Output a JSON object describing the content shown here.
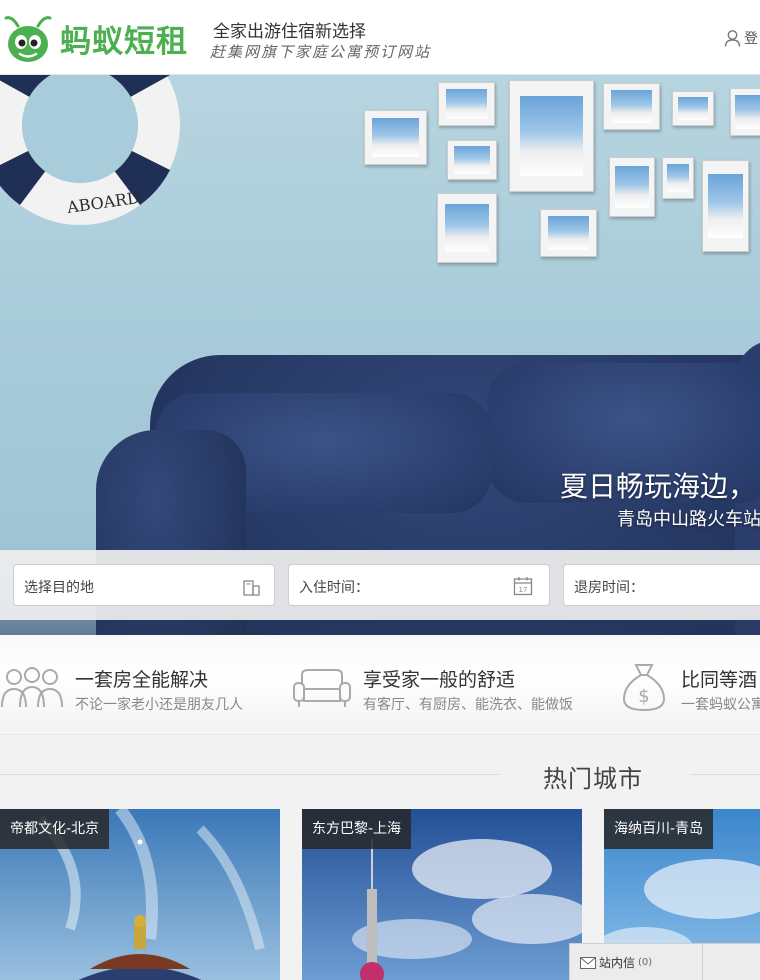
{
  "header": {
    "logo_text": "蚂蚁短租",
    "slogan_main": "全家出游住宿新选择",
    "slogan_sub": "赶集网旗下家庭公寓预订网站",
    "login_label": "登"
  },
  "hero": {
    "lifebuoy_text": "ABOARD",
    "title": "夏日畅玩海边，",
    "subtitle": "青岛中山路火车站"
  },
  "search": {
    "destination_placeholder": "选择目的地",
    "checkin_placeholder": "入住时间：",
    "checkout_placeholder": "退房时间：",
    "calendar_day": "17"
  },
  "features": [
    {
      "icon": "family-icon",
      "title": "一套房全能解决",
      "subtitle": "不论一家老小还是朋友几人"
    },
    {
      "icon": "sofa-icon",
      "title": "享受家一般的舒适",
      "subtitle": "有客厅、有厨房、能洗衣、能做饭"
    },
    {
      "icon": "money-bag-icon",
      "title": "比同等酒",
      "subtitle": "一套蚂蚁公寓"
    }
  ],
  "hot_cities": {
    "title": "热门城市",
    "cities": [
      {
        "label": "帝都文化-北京"
      },
      {
        "label": "东方巴黎-上海"
      },
      {
        "label": "海纳百川-青岛"
      }
    ]
  },
  "message": {
    "label": "站内信",
    "count": "(0)"
  },
  "colors": {
    "brand_green": "#4caf50",
    "sofa_navy": "#2b3f6e",
    "wall_blue": "#a8cbd9"
  }
}
